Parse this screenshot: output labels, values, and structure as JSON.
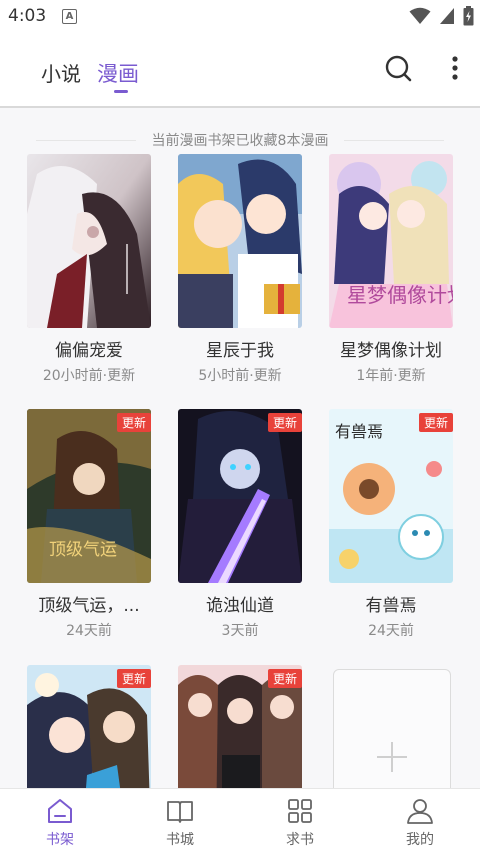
{
  "status_bar": {
    "time": "4:03",
    "notification_badge": "A"
  },
  "header": {
    "tabs": [
      {
        "label": "小说",
        "active": false
      },
      {
        "label": "漫画",
        "active": true
      }
    ],
    "accent_color": "#7a5bd0"
  },
  "shelf": {
    "summary": "当前漫画书架已收藏8本漫画",
    "items": [
      {
        "title": "偏偏宠爱",
        "update": "20小时前·更新",
        "badge": ""
      },
      {
        "title": "星辰于我",
        "update": "5小时前·更新",
        "badge": ""
      },
      {
        "title": "星梦偶像计划",
        "update": "1年前·更新",
        "badge": ""
      },
      {
        "title": "顶级气运，...",
        "update": "24天前",
        "badge": "更新"
      },
      {
        "title": "诡浊仙道",
        "update": "3天前",
        "badge": "更新"
      },
      {
        "title": "有兽焉",
        "update": "24天前",
        "badge": "更新"
      },
      {
        "title": "",
        "update": "",
        "badge": "更新"
      },
      {
        "title": "",
        "update": "",
        "badge": "更新"
      }
    ]
  },
  "bottom_nav": [
    {
      "label": "书架",
      "icon": "bookshelf-icon",
      "active": true
    },
    {
      "label": "书城",
      "icon": "book-open-icon",
      "active": false
    },
    {
      "label": "求书",
      "icon": "grid-icon",
      "active": false
    },
    {
      "label": "我的",
      "icon": "user-icon",
      "active": false
    }
  ]
}
